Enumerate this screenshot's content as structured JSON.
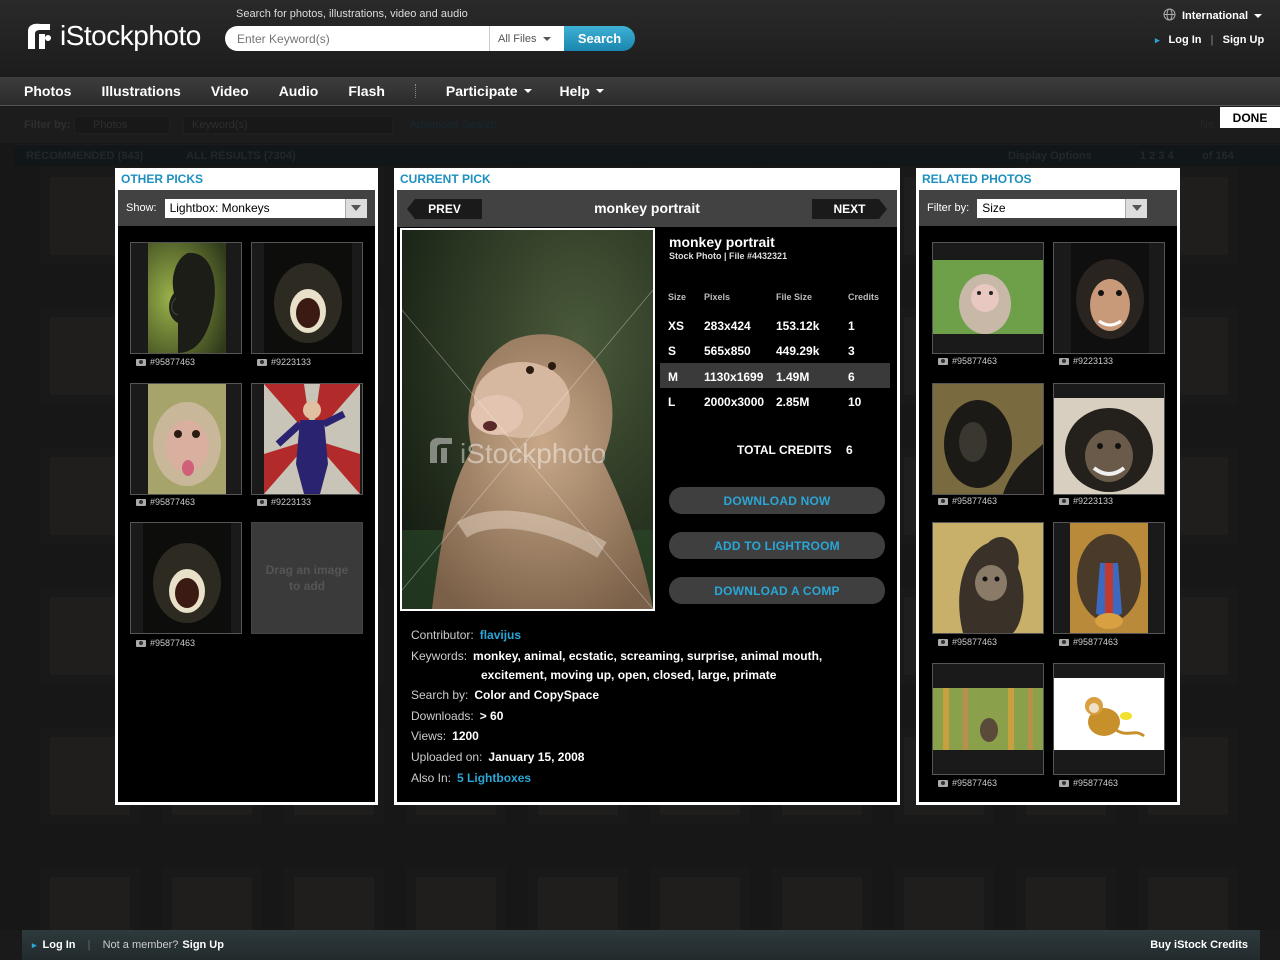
{
  "header": {
    "logo_text": "iStockphoto",
    "search_hint": "Search for photos, illustrations, video and audio",
    "search_placeholder": "Enter Keyword(s)",
    "file_filter": "All Files",
    "search_button": "Search",
    "region": "International",
    "login": "Log In",
    "signup": "Sign Up"
  },
  "nav": {
    "items": [
      "Photos",
      "Illustrations",
      "Video",
      "Audio",
      "Flash"
    ],
    "participate": "Participate",
    "help": "Help"
  },
  "background": {
    "filter_label": "Filter by:",
    "filter_type": "Photos",
    "keyword_placeholder": "Keyword(s)",
    "advanced": "Advanced Search",
    "next": "Ne...",
    "tab_recommended": "RECOMMENDED (843)",
    "tab_all": "ALL RESULTS (7304)",
    "display_options": "Display Options",
    "pages": "1 2 3 4",
    "of_total": "of  164"
  },
  "done_button": "DONE",
  "other_picks": {
    "title": "OTHER PICKS",
    "show_label": "Show:",
    "show_value": "Lightbox: Monkeys",
    "thumbs": [
      {
        "id": "#95877463"
      },
      {
        "id": "#9223133"
      },
      {
        "id": "#95877463"
      },
      {
        "id": "#9223133"
      },
      {
        "id": "#95877463"
      }
    ],
    "drag_text": "Drag an image to add"
  },
  "current_pick": {
    "title": "CURRENT PICK",
    "prev": "PREV",
    "next": "NEXT",
    "image_title": "monkey portrait",
    "name": "monkey portrait",
    "subtitle": "Stock Photo  |  File #4432321",
    "watermark": "iStockphoto",
    "table_headers": {
      "size": "Size",
      "pixels": "Pixels",
      "file_size": "File Size",
      "credits": "Credits"
    },
    "sizes": [
      {
        "size": "XS",
        "pixels": "283x424",
        "file_size": "153.12k",
        "credits": "1"
      },
      {
        "size": "S",
        "pixels": "565x850",
        "file_size": "449.29k",
        "credits": "3"
      },
      {
        "size": "M",
        "pixels": "1130x1699",
        "file_size": "1.49M",
        "credits": "6"
      },
      {
        "size": "L",
        "pixels": "2000x3000",
        "file_size": "2.85M",
        "credits": "10"
      }
    ],
    "total_label": "TOTAL CREDITS",
    "total_value": "6",
    "download_now": "DOWNLOAD NOW",
    "add_lightroom": "ADD TO LIGHTROOM",
    "download_comp": "DOWNLOAD A COMP",
    "contributor_label": "Contributor:",
    "contributor": "flavijus",
    "keywords_label": "Keywords:",
    "keywords_line1": "monkey, animal, ecstatic, screaming, surprise, animal mouth,",
    "keywords_line2": "excitement, moving up, open, closed, large, primate",
    "searchby_label": "Search by:",
    "searchby": "Color and CopySpace",
    "downloads_label": "Downloads:",
    "downloads": "> 60",
    "views_label": "Views:",
    "views": "1200",
    "uploaded_label": "Uploaded on:",
    "uploaded": "January 15, 2008",
    "alsoin_label": "Also In:",
    "alsoin": "5 Lightboxes"
  },
  "related": {
    "title": "RELATED PHOTOS",
    "filter_label": "Filter by:",
    "filter_value": "Size",
    "thumbs": [
      {
        "id": "#95877463"
      },
      {
        "id": "#9223133"
      },
      {
        "id": "#95877463"
      },
      {
        "id": "#9223133"
      },
      {
        "id": "#95877463"
      },
      {
        "id": "#95877463"
      },
      {
        "id": "#95877463"
      },
      {
        "id": "#95877463"
      }
    ]
  },
  "footer": {
    "login": "Log In",
    "not_member": "Not a member?",
    "signup": "Sign Up",
    "buy": "Buy iStock Credits"
  }
}
